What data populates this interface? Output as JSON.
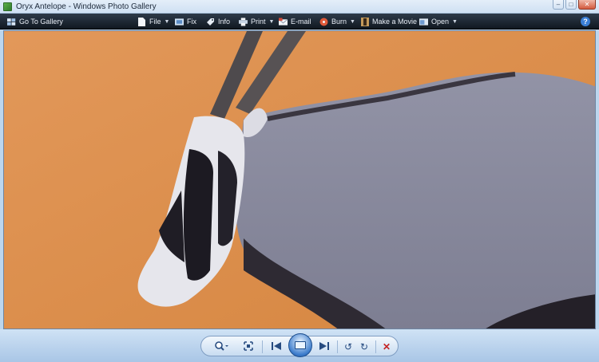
{
  "window": {
    "title": "Oryx Antelope - Windows Photo Gallery",
    "controls": [
      "minimize-icon",
      "maximize-icon",
      "close-icon"
    ]
  },
  "toolbar": {
    "go_to_gallery": "Go To Gallery",
    "file": "File",
    "fix": "Fix",
    "info": "Info",
    "print": "Print",
    "email": "E-mail",
    "burn": "Burn",
    "make_movie": "Make a Movie",
    "open": "Open",
    "help": "?"
  },
  "photo": {
    "subject": "oryx-antelope-photo",
    "colors": {
      "background": "#d98c4d",
      "body": "#8a8b9c"
    }
  },
  "playback": {
    "icons": [
      "zoom-icon",
      "fit-to-window-icon",
      "previous-icon",
      "slideshow-icon",
      "next-icon",
      "rotate-counterclockwise-icon",
      "rotate-clockwise-icon",
      "delete-icon"
    ]
  }
}
